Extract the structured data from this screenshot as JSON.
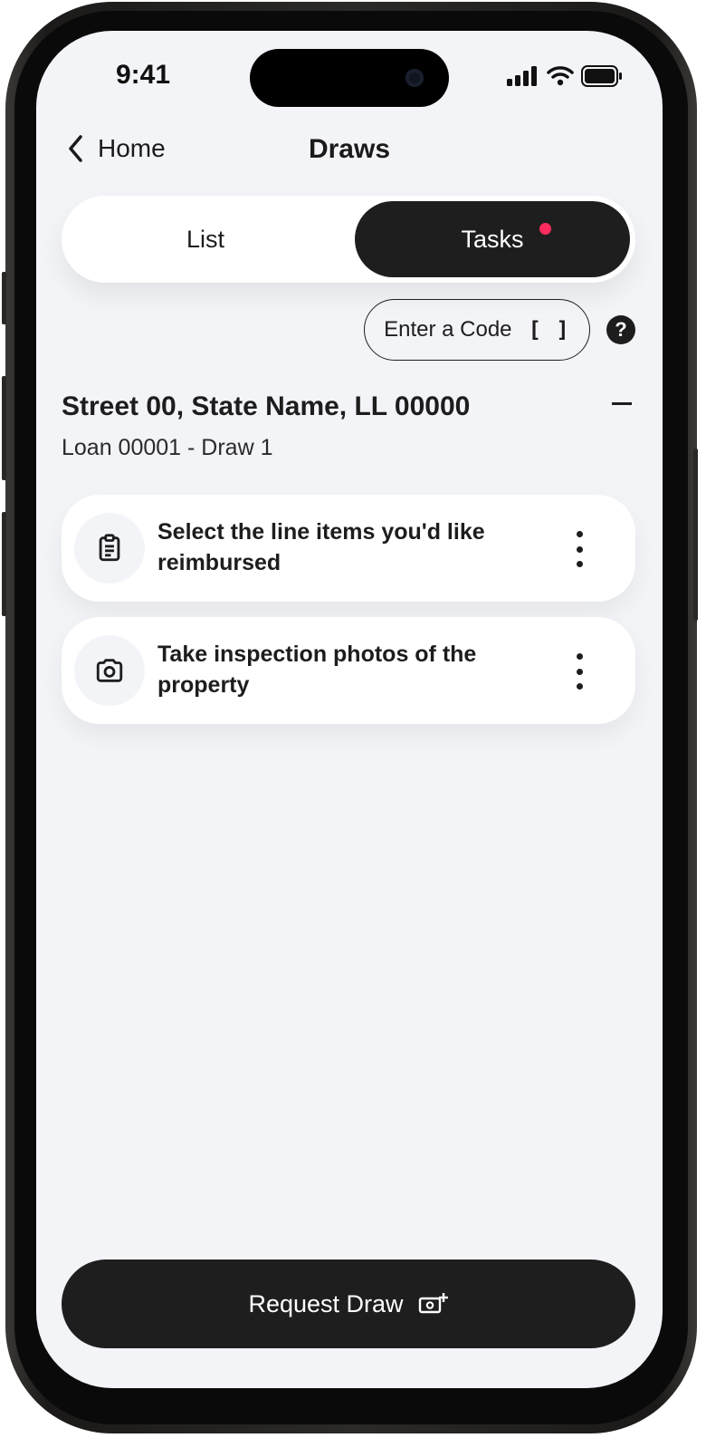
{
  "status_bar": {
    "time": "9:41"
  },
  "nav": {
    "back_label": "Home",
    "title": "Draws"
  },
  "segments": {
    "list_label": "List",
    "tasks_label": "Tasks",
    "tasks_has_notification": true
  },
  "code_button": {
    "label": "Enter a Code",
    "icon": "[ ]"
  },
  "help_icon": "?",
  "property": {
    "address": "Street 00, State Name, LL 00000",
    "loan": "Loan 00001 - Draw 1"
  },
  "tasks": [
    {
      "icon": "clipboard-icon",
      "text": "Select the line items you'd like reimbursed"
    },
    {
      "icon": "camera-icon",
      "text": "Take inspection photos of the property"
    }
  ],
  "request_button": {
    "label": "Request Draw",
    "icon": "money-add-icon"
  },
  "colors": {
    "background": "#f3f4f8",
    "card": "#ffffff",
    "dark": "#1f1e1f",
    "notification": "#ff2b5e"
  }
}
